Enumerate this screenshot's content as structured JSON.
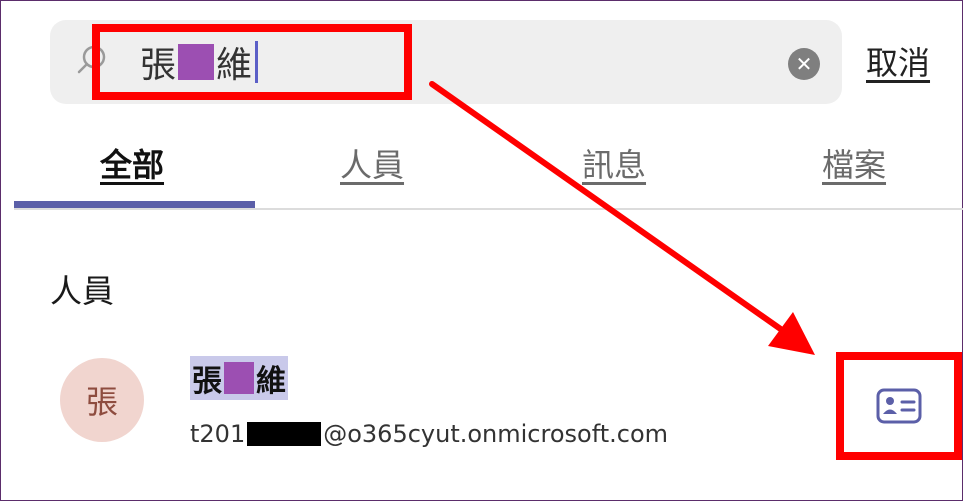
{
  "search": {
    "query_part1": "張",
    "query_part2": "維",
    "clear_label": "✕",
    "cancel_label": "取消"
  },
  "tabs": [
    {
      "label": "全部",
      "active": true
    },
    {
      "label": "人員",
      "active": false
    },
    {
      "label": "訊息",
      "active": false
    },
    {
      "label": "檔案",
      "active": false
    }
  ],
  "people_section": {
    "heading": "人員",
    "person": {
      "avatar_initial": "張",
      "name_part1": "張",
      "name_part2": "維",
      "email_prefix": "t201",
      "email_suffix": "@o365cyut.onmicrosoft.com"
    }
  },
  "colors": {
    "annotation": "#ff0000",
    "accent": "#5b5fa8",
    "redaction": "#9c4fb2",
    "avatar_bg": "#f1d5cf"
  },
  "icons": [
    "search-icon",
    "clear-icon",
    "contact-card-icon"
  ]
}
